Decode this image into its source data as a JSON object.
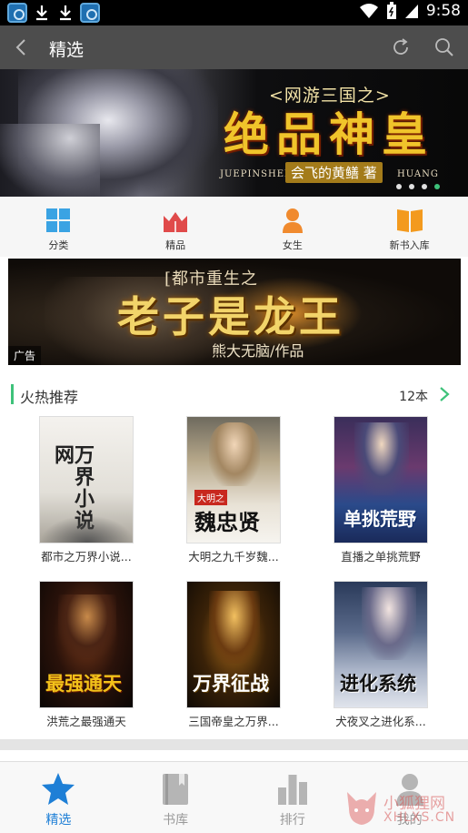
{
  "status_bar": {
    "time": "9:58"
  },
  "header": {
    "title": "精选"
  },
  "banner": {
    "subtitle": "<网游三国之>",
    "title": "绝品神皇",
    "en_left": "JUEPINSHEN",
    "author": "会飞的黄鳝 著",
    "en_right": "HUANG",
    "dots": 4,
    "active_dot": 4
  },
  "categories": [
    {
      "label": "分类",
      "icon": "grid-icon",
      "color": "#3aa3e3"
    },
    {
      "label": "精品",
      "icon": "crown-book-icon",
      "color": "#e04a4a"
    },
    {
      "label": "女生",
      "icon": "female-icon",
      "color": "#f08a2e"
    },
    {
      "label": "新书入库",
      "icon": "open-book-icon",
      "color": "#f39a1e"
    }
  ],
  "ad": {
    "subtitle": "[都市重生之",
    "title": "老子是龙王",
    "author": "熊大无脑/作品",
    "badge": "广告"
  },
  "section": {
    "title": "火热推荐",
    "count": "12本"
  },
  "books": [
    {
      "title": "都市之万界小说...",
      "cover_text": "万界小说网"
    },
    {
      "title": "大明之九千岁魏...",
      "cover_text": "魏忠贤"
    },
    {
      "title": "直播之单挑荒野",
      "cover_text": "单挑荒野"
    },
    {
      "title": "洪荒之最强通天",
      "cover_text": "最强通天"
    },
    {
      "title": "三国帝皇之万界...",
      "cover_text": "万界征战"
    },
    {
      "title": "犬夜叉之进化系...",
      "cover_text": "进化系统"
    }
  ],
  "tabs": [
    {
      "label": "精选",
      "icon": "star-icon",
      "active": true
    },
    {
      "label": "书库",
      "icon": "bookshelf-icon",
      "active": false
    },
    {
      "label": "排行",
      "icon": "ranking-icon",
      "active": false
    },
    {
      "label": "我的",
      "icon": "user-icon",
      "active": false
    }
  ],
  "watermark": {
    "cn": "小狐狸网",
    "en": "XHLXS.CN"
  },
  "colors": {
    "accent": "#3ec27a",
    "tab_active": "#1e7fd6",
    "app_bar": "#4d4d4d"
  }
}
